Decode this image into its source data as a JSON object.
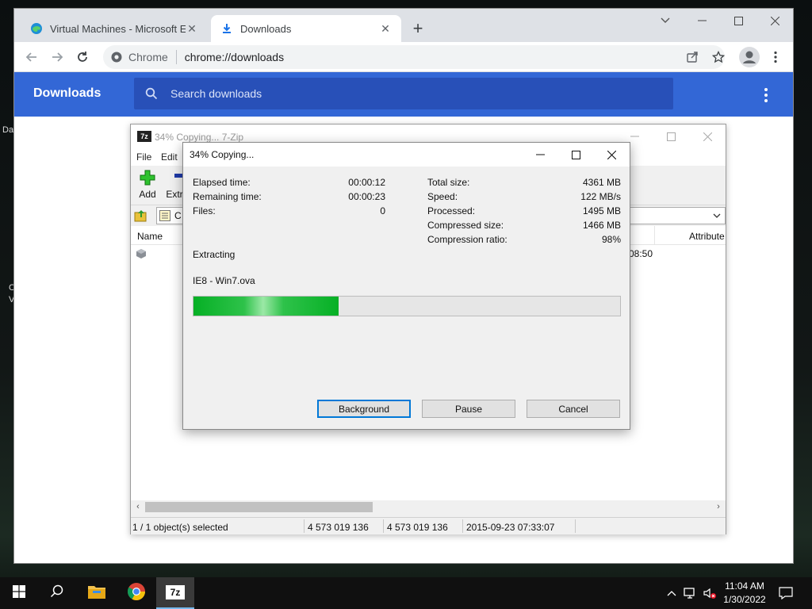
{
  "desktop": {
    "fragments": [
      "Da",
      "C",
      "V"
    ]
  },
  "chrome": {
    "tabs": [
      {
        "title": "Virtual Machines - Microsoft Edg",
        "active": false
      },
      {
        "title": "Downloads",
        "active": true
      }
    ],
    "omnibox": {
      "chip": "Chrome",
      "url": "chrome://downloads"
    },
    "downloads_page": {
      "title": "Downloads",
      "search_placeholder": "Search downloads"
    },
    "colors": {
      "header_blue": "#3367d6",
      "search_blue": "#2850b8"
    }
  },
  "sevenzip": {
    "window_title": "34% Copying... 7-Zip",
    "menu": [
      "File",
      "Edit"
    ],
    "toolbar": {
      "add_label": "Add",
      "extract_label": "Extr"
    },
    "address_partial": "C",
    "columns": {
      "name": "Name",
      "attributes": "Attribute"
    },
    "row_fragments": {
      "time": "08:50"
    },
    "status": {
      "selection": "1 / 1 object(s) selected",
      "size": "4 573 019 136",
      "packed": "4 573 019 136",
      "modified": "2015-09-23 07:33:07"
    }
  },
  "progress_dialog": {
    "title": "34% Copying...",
    "left_stats": [
      {
        "label": "Elapsed time:",
        "value": "00:00:12"
      },
      {
        "label": "Remaining time:",
        "value": "00:00:23"
      },
      {
        "label": "Files:",
        "value": "0"
      }
    ],
    "right_stats": [
      {
        "label": "Total size:",
        "value": "4361 MB"
      },
      {
        "label": "Speed:",
        "value": "122 MB/s"
      },
      {
        "label": "Processed:",
        "value": "1495 MB"
      },
      {
        "label": "Compressed size:",
        "value": "1466 MB"
      },
      {
        "label": "Compression ratio:",
        "value": "98%"
      }
    ],
    "operation": "Extracting",
    "current_file": "IE8 - Win7.ova",
    "progress_fraction": 0.34,
    "progress_color": "#06b025",
    "buttons": {
      "background": "Background",
      "pause": "Pause",
      "cancel": "Cancel"
    }
  },
  "taskbar": {
    "apps": [
      {
        "icon": "file-explorer-icon"
      },
      {
        "icon": "chrome-icon"
      },
      {
        "icon": "7zip-icon",
        "label": "7z",
        "active": true
      }
    ],
    "clock": {
      "time": "11:04 AM",
      "date": "1/30/2022"
    }
  }
}
